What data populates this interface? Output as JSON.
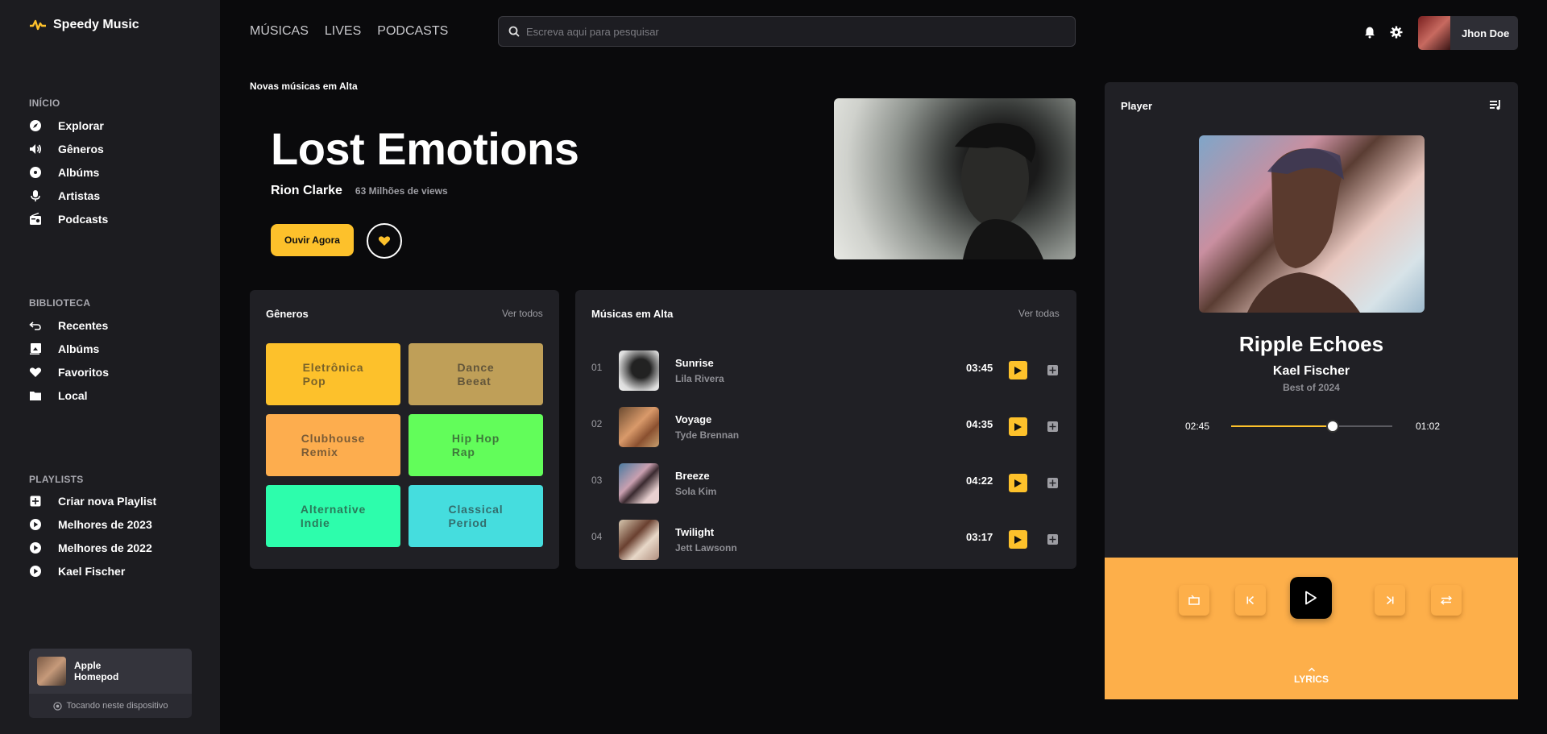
{
  "app": {
    "name": "Speedy Music"
  },
  "sidebar": {
    "inicio": {
      "title": "INÍCIO",
      "items": [
        {
          "label": "Explorar",
          "icon": "compass-icon"
        },
        {
          "label": "Gêneros",
          "icon": "speaker-icon"
        },
        {
          "label": "Albúms",
          "icon": "disc-icon"
        },
        {
          "label": "Artistas",
          "icon": "microphone-icon"
        },
        {
          "label": "Podcasts",
          "icon": "radio-icon"
        }
      ]
    },
    "biblioteca": {
      "title": "BIBLIOTECA",
      "items": [
        {
          "label": "Recentes",
          "icon": "history-icon"
        },
        {
          "label": "Albúms",
          "icon": "album-icon"
        },
        {
          "label": "Favoritos",
          "icon": "heart-icon"
        },
        {
          "label": "Local",
          "icon": "folder-icon"
        }
      ]
    },
    "playlists": {
      "title": "PLAYLISTS",
      "items": [
        {
          "label": "Criar nova Playlist",
          "icon": "plus-square-icon"
        },
        {
          "label": "Melhores de 2023",
          "icon": "play-circle-icon"
        },
        {
          "label": "Melhores de 2022",
          "icon": "play-circle-icon"
        },
        {
          "label": "Kael Fischer",
          "icon": "play-circle-icon"
        }
      ]
    },
    "device": {
      "name": "Apple Homepod",
      "status": "Tocando neste dispositivo"
    }
  },
  "topbar": {
    "nav": [
      "MÚSICAS",
      "LIVES",
      "PODCASTS"
    ],
    "search_placeholder": "Escreva aqui para pesquisar",
    "user_name": "Jhon Doe"
  },
  "hero": {
    "tag": "Novas músicas em Alta",
    "title": "Lost Emotions",
    "artist": "Rion Clarke",
    "views": "63 Milhões de views",
    "listen_label": "Ouvir Agora"
  },
  "genres": {
    "title": "Gêneros",
    "link": "Ver todos",
    "items": [
      {
        "label": "Eletrônica\nPop",
        "color": "#fdc12b"
      },
      {
        "label": "Dance\nBeeat",
        "color": "#bf9f58"
      },
      {
        "label": "Clubhouse\nRemix",
        "color": "#fdad4e"
      },
      {
        "label": "Hip Hop\nRap",
        "color": "#62fd5a"
      },
      {
        "label": "Alternative\nIndie",
        "color": "#2dfdac"
      },
      {
        "label": "Classical\nPeriod",
        "color": "#45ddde"
      }
    ]
  },
  "top_tracks": {
    "title": "Músicas em Alta",
    "link": "Ver todas",
    "items": [
      {
        "num": "01",
        "name": "Sunrise",
        "artist": "Lila Rivera",
        "duration": "03:45"
      },
      {
        "num": "02",
        "name": "Voyage",
        "artist": "Tyde Brennan",
        "duration": "04:35"
      },
      {
        "num": "03",
        "name": "Breeze",
        "artist": "Sola Kim",
        "duration": "04:22"
      },
      {
        "num": "04",
        "name": "Twilight",
        "artist": "Jett Lawsonn",
        "duration": "03:17"
      }
    ]
  },
  "player": {
    "title": "Player",
    "song": "Ripple Echoes",
    "artist": "Kael Fischer",
    "album": "Best of 2024",
    "elapsed": "02:45",
    "remaining": "01:02",
    "progress": 0.63,
    "lyrics_label": "LYRICS"
  },
  "colors": {
    "accent": "#fdc12b",
    "controls_bg": "#fdaf4a"
  }
}
